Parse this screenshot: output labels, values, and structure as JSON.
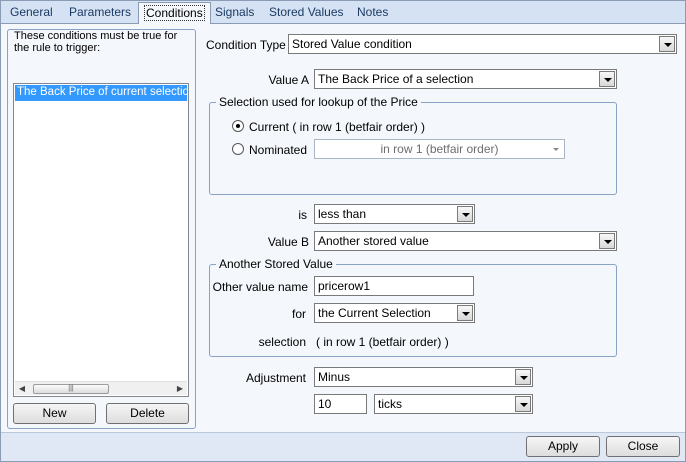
{
  "tabs": [
    {
      "label": "General"
    },
    {
      "label": "Parameters"
    },
    {
      "label": "Conditions"
    },
    {
      "label": "Signals"
    },
    {
      "label": "Stored Values"
    },
    {
      "label": "Notes"
    }
  ],
  "left_panel": {
    "title": "These conditions must be true for the rule to trigger:",
    "items": [
      "The Back Price of current selection"
    ],
    "new_label": "New",
    "delete_label": "Delete"
  },
  "condition_type": {
    "label": "Condition Type",
    "value": "Stored Value condition"
  },
  "value_a": {
    "label": "Value A",
    "value": "The Back Price of a selection"
  },
  "selection_group": {
    "title": "Selection used for lookup of the Price",
    "current_label": "Current ( in row 1 (betfair order) )",
    "nominated_label": "Nominated",
    "nominated_value": "in row 1 (betfair order)"
  },
  "is": {
    "label": "is",
    "value": "less than"
  },
  "value_b": {
    "label": "Value B",
    "value": "Another stored value"
  },
  "another_group": {
    "title": "Another Stored Value",
    "other_name_label": "Other value name",
    "other_name_value": "pricerow1",
    "for_label": "for",
    "for_value": "the Current Selection",
    "selection_label": "selection",
    "selection_value": "( in row 1 (betfair order) )"
  },
  "adjustment": {
    "label": "Adjustment",
    "value": "Minus",
    "amount": "10",
    "unit": "ticks"
  },
  "footer": {
    "apply_label": "Apply",
    "close_label": "Close"
  }
}
